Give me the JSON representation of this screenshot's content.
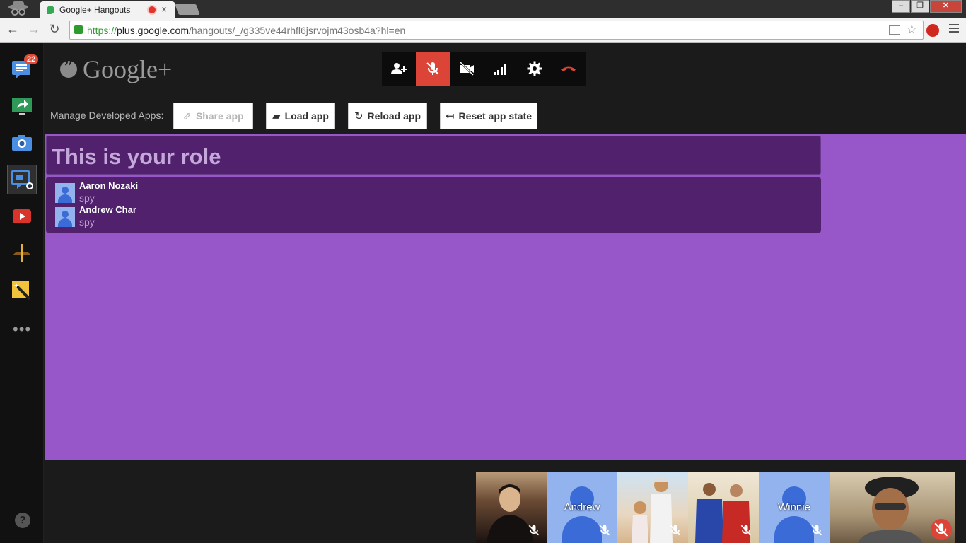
{
  "browser": {
    "tab_title": "Google+ Hangouts",
    "tab_close": "×",
    "url_scheme": "https://",
    "url_host": "plus.google.com",
    "url_path": "/hangouts/_/g335ve44rhfl6jsrvojm43osb4a?hl=en",
    "window_buttons": [
      "‒",
      "❐",
      "✕"
    ]
  },
  "rail": {
    "items": [
      {
        "name": "chat",
        "icon": "chat-icon",
        "badge": "22"
      },
      {
        "name": "screenshare",
        "icon": "screenshare-icon"
      },
      {
        "name": "capture",
        "icon": "camera-icon"
      },
      {
        "name": "developer-app",
        "icon": "app-dev-icon"
      },
      {
        "name": "youtube",
        "icon": "youtube-icon"
      },
      {
        "name": "effects",
        "icon": "mustache-icon"
      },
      {
        "name": "toolbox",
        "icon": "wand-icon"
      }
    ],
    "more": "•••",
    "help": "?"
  },
  "header": {
    "logo_text": "Google+"
  },
  "controls": [
    {
      "name": "invite",
      "icon": "add-person-icon"
    },
    {
      "name": "mic",
      "icon": "mic-muted-icon",
      "active": true
    },
    {
      "name": "camera",
      "icon": "camera-off-icon"
    },
    {
      "name": "bandwidth",
      "icon": "signal-bars-icon"
    },
    {
      "name": "settings",
      "icon": "gear-icon"
    },
    {
      "name": "hangup",
      "icon": "hangup-icon"
    }
  ],
  "devbar": {
    "label": "Manage Developed Apps:",
    "share": "Share app",
    "load": "Load app",
    "reload": "Reload app",
    "reset": "Reset app state"
  },
  "app": {
    "role_title": "This is your role",
    "players": [
      {
        "name": "Aaron Nozaki",
        "role": "spy"
      },
      {
        "name": "Andrew Char",
        "role": "spy"
      }
    ]
  },
  "filmstrip": [
    {
      "name": "",
      "type": "photo"
    },
    {
      "name": "Andrew",
      "type": "avatar"
    },
    {
      "name": "",
      "type": "photo"
    },
    {
      "name": "",
      "type": "photo"
    },
    {
      "name": "Winnie",
      "type": "avatar"
    },
    {
      "name": "",
      "type": "self"
    }
  ],
  "colors": {
    "stage_bg": "#9857c8",
    "panel_bg": "#51216e",
    "mic_active": "#db4437",
    "avatar_blue": "#93b3ef"
  }
}
